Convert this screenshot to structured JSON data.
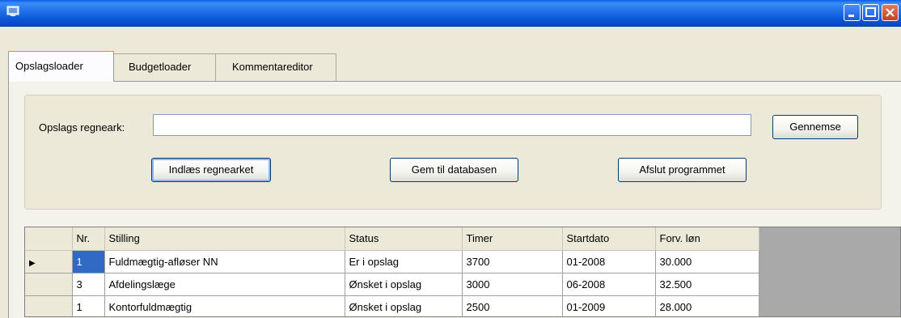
{
  "window": {
    "title": ""
  },
  "tabs": [
    "Opslagsloader",
    "Budgetloader",
    "Kommentareditor"
  ],
  "form": {
    "label": "Opslags regneark:",
    "input_value": "",
    "browse_button": "Gennemse",
    "load_button": "Indlæs regnearket",
    "save_button": "Gem til databasen",
    "quit_button": "Afslut programmet"
  },
  "grid": {
    "columns": [
      "Nr.",
      "Stilling",
      "Status",
      "Timer",
      "Startdato",
      "Forv. løn"
    ],
    "rows": [
      [
        "1",
        "Fuldmægtig-afløser NN",
        "Er i opslag",
        "3700",
        "01-2008",
        "30.000"
      ],
      [
        "3",
        "Afdelingslæge",
        "Ønsket i opslag",
        "3000",
        "06-2008",
        "32.500"
      ],
      [
        "1",
        "Kontorfuldmægtig",
        "Ønsket i opslag",
        "2500",
        "01-2009",
        "28.000"
      ]
    ],
    "current_row_marker": "▶"
  }
}
